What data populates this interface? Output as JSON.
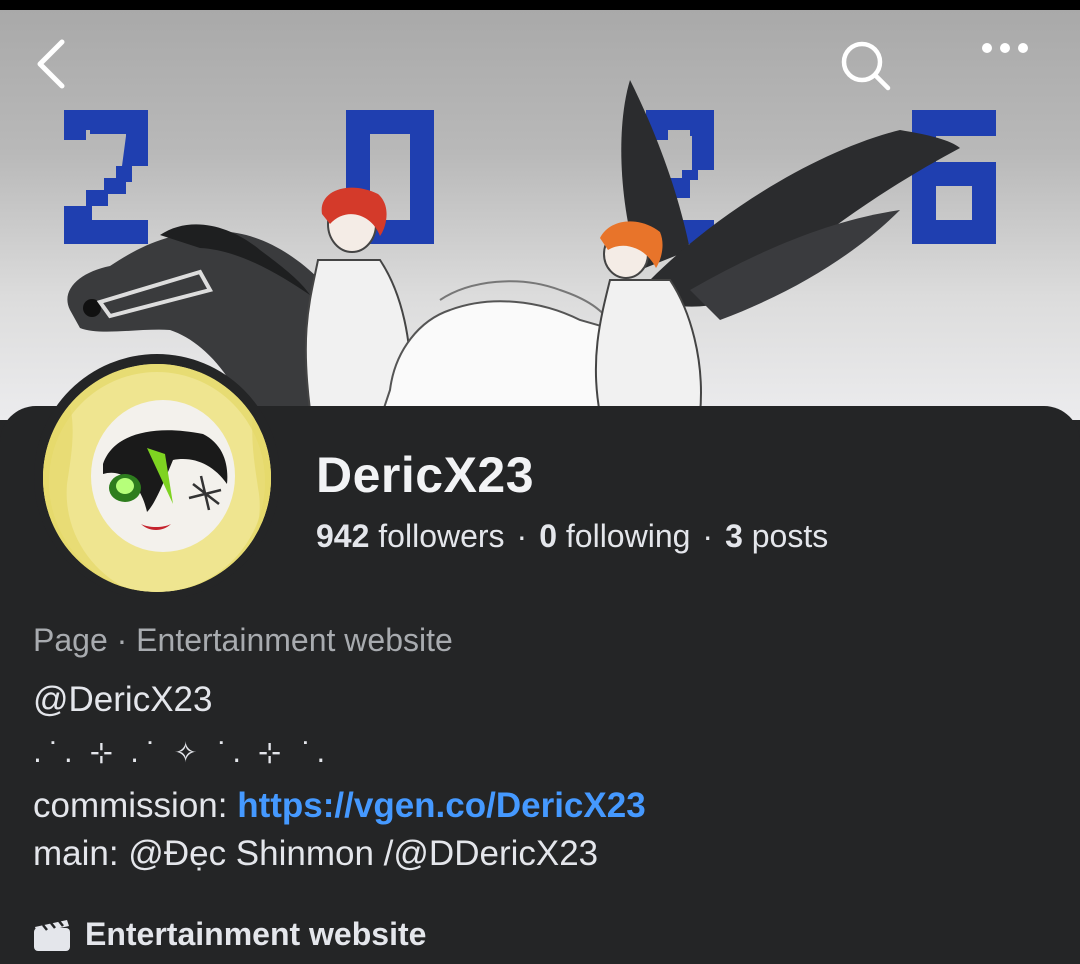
{
  "header": {
    "back_icon": "chevron-left-icon",
    "search_icon": "search-icon",
    "more_icon": "more-horizontal-icon"
  },
  "cover": {
    "year_digits": [
      "2",
      "0",
      "2",
      "6"
    ],
    "digit_color": "#1f3fb0"
  },
  "profile": {
    "name": "DericX23",
    "followers_count": "942",
    "followers_label": "followers",
    "following_count": "0",
    "following_label": "following",
    "posts_count": "3",
    "posts_label": "posts",
    "separator": "·"
  },
  "about": {
    "category": "Page · Entertainment website",
    "handle": "@DericX23",
    "sparkles": ".˙. ⊹ .˙ ✧ ˙. ⊹ ˙.",
    "commission_label": "commission: ",
    "commission_link": "https://vgen.co/DericX23",
    "main_line": "main: @Đẹc Shinmon /@DDericX23"
  },
  "details": {
    "category_icon": "clapperboard-icon",
    "category_text": "Entertainment website"
  },
  "colors": {
    "background": "#242526",
    "text": "#e4e6eb",
    "muted": "#a8abaf",
    "link": "#4599ff"
  }
}
